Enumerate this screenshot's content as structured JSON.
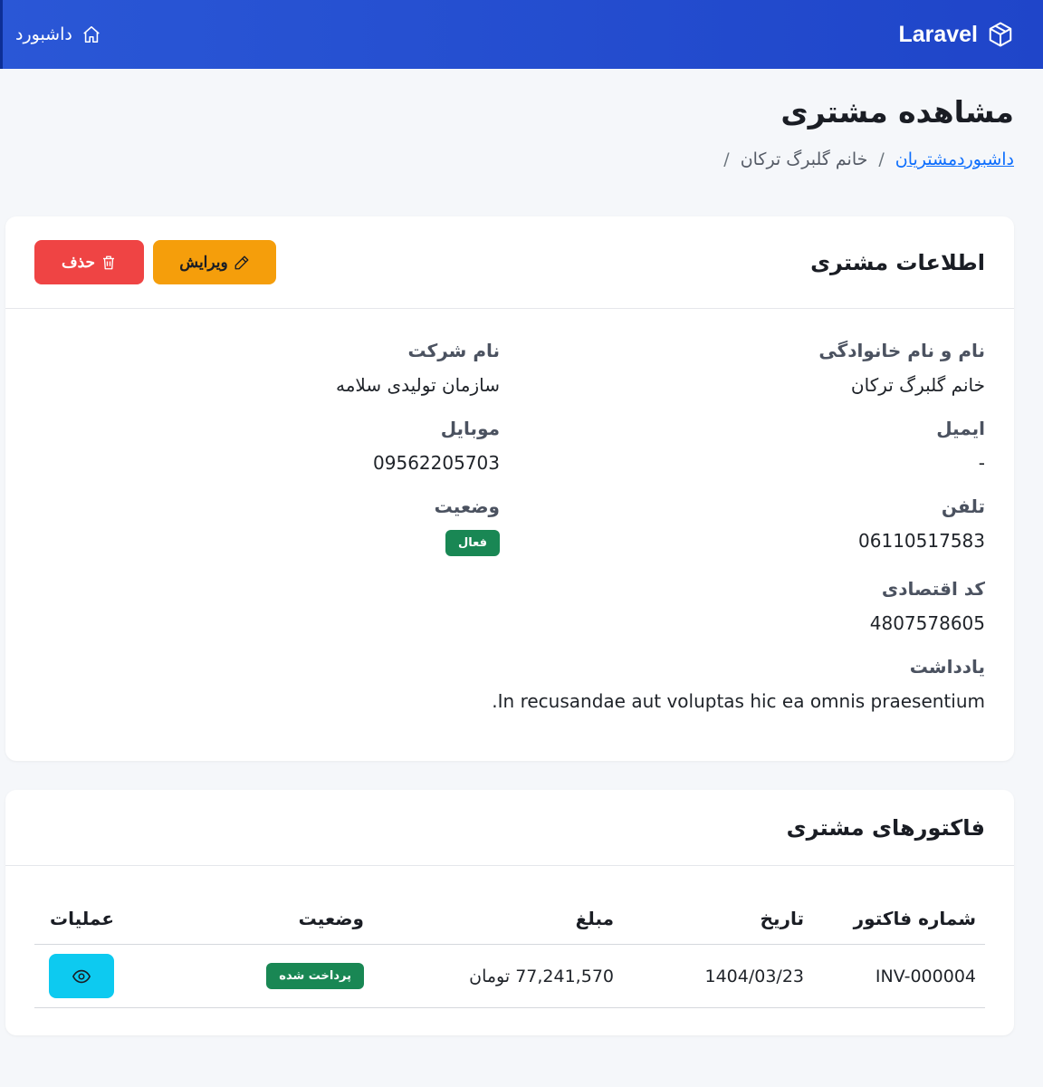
{
  "navbar": {
    "brand": "Laravel",
    "dashboard_link": "داشبورد"
  },
  "header": {
    "title": "مشاهده مشتری",
    "breadcrumb": {
      "dashboard": "داشبورد",
      "customers": "مشتریان",
      "current": "خانم گلبرگ ترکان",
      "separator": "/"
    }
  },
  "customer_card": {
    "title": "اطلاعات مشتری",
    "edit_label": "ویرایش",
    "delete_label": "حذف",
    "fields": {
      "full_name_label": "نام و نام خانوادگی",
      "full_name": "خانم گلبرگ ترکان",
      "company_label": "نام شرکت",
      "company": "سازمان تولیدی سلامه",
      "email_label": "ایمیل",
      "email": "-",
      "mobile_label": "موبایل",
      "mobile": "09562205703",
      "phone_label": "تلفن",
      "phone": "06110517583",
      "status_label": "وضعیت",
      "status": "فعال",
      "economic_code_label": "کد اقتصادی",
      "economic_code": "4807578605",
      "note_label": "یادداشت",
      "note": "In recusandae aut voluptas hic ea omnis praesentium."
    }
  },
  "invoices_card": {
    "title": "فاکتورهای مشتری",
    "columns": {
      "number": "شماره فاکتور",
      "date": "تاریخ",
      "amount": "مبلغ",
      "status": "وضعیت",
      "actions": "عملیات"
    },
    "rows": [
      {
        "number": "INV-000004",
        "date": "1404/03/23",
        "amount": "77,241,570 تومان",
        "status": "پرداخت شده"
      }
    ]
  },
  "colors": {
    "navbar": "#2a57d6",
    "edit": "#f59e0b",
    "delete": "#ef4444",
    "success": "#198754",
    "view": "#0dcaf0",
    "link": "#0d6efd"
  }
}
